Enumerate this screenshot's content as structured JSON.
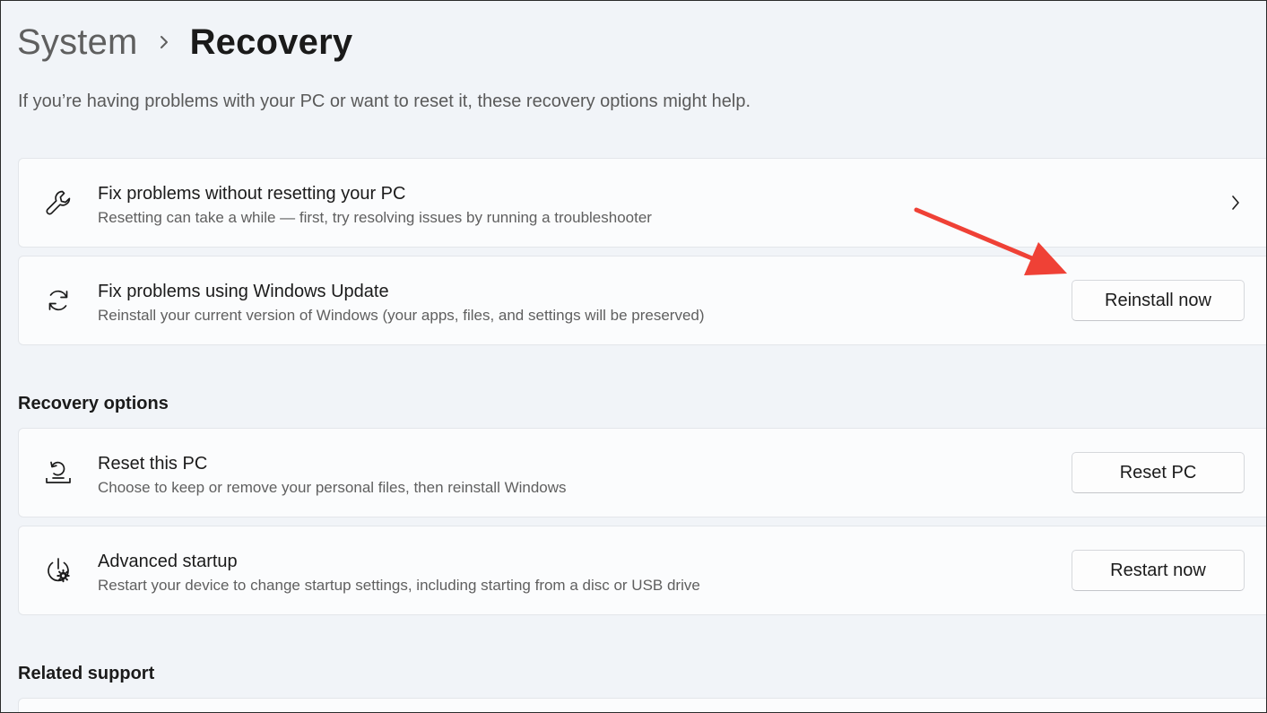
{
  "breadcrumb": {
    "parent": "System",
    "current": "Recovery"
  },
  "intro": "If you’re having problems with your PC or want to reset it, these recovery options might help.",
  "cards_top": [
    {
      "icon": "wrench-icon",
      "title": "Fix problems without resetting your PC",
      "desc": "Resetting can take a while — first, try resolving issues by running a troubleshooter",
      "action": "chevron"
    },
    {
      "icon": "sync-icon",
      "title": "Fix problems using Windows Update",
      "desc": "Reinstall your current version of Windows (your apps, files, and settings will be preserved)",
      "button": "Reinstall now"
    }
  ],
  "recovery_options": {
    "header": "Recovery options",
    "items": [
      {
        "icon": "reset-pc-icon",
        "title": "Reset this PC",
        "desc": "Choose to keep or remove your personal files, then reinstall Windows",
        "button": "Reset PC"
      },
      {
        "icon": "advanced-startup-icon",
        "title": "Advanced startup",
        "desc": "Restart your device to change startup settings, including starting from a disc or USB drive",
        "button": "Restart now"
      }
    ]
  },
  "related_support": {
    "header": "Related support"
  },
  "colors": {
    "annotation_arrow": "#ef4136",
    "background": "#f1f4f8",
    "card": "#fbfcfd"
  }
}
